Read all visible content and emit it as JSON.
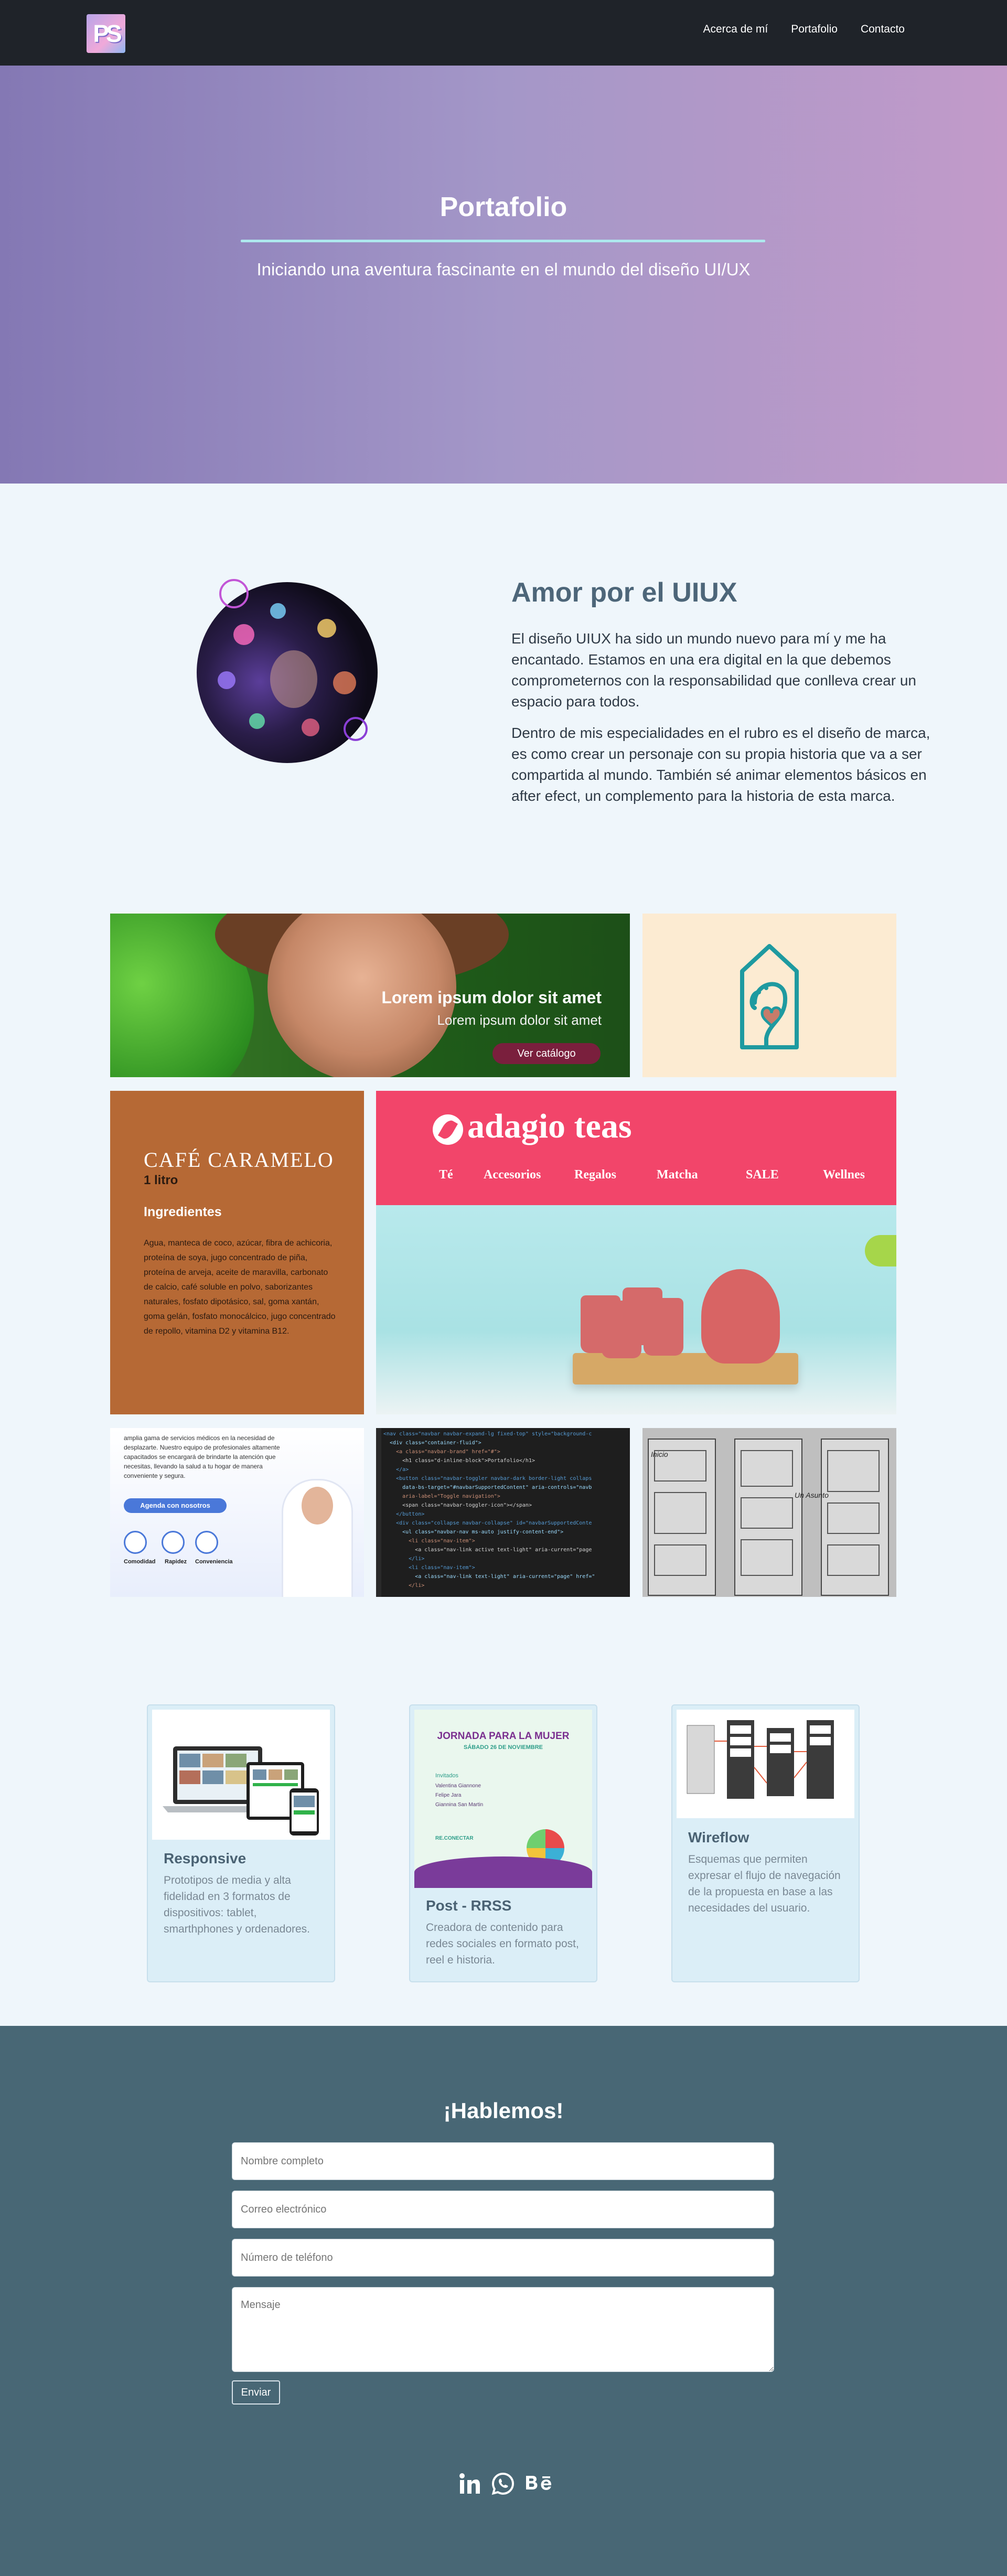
{
  "nav": {
    "brand_glyph": "PS",
    "links": [
      "Acerca de mí",
      "Portafolio",
      "Contacto"
    ]
  },
  "hero": {
    "title": "Portafolio",
    "subtitle": "Iniciando una aventura fascinante en el mundo del diseño UI/UX"
  },
  "about": {
    "title": "Amor por el UIUX",
    "p1": "El diseño UIUX ha sido un mundo nuevo para mí y me ha encantado. Estamos en una era digital en la que debemos comprometernos con la responsabilidad que conlleva crear un espacio para todos.",
    "p2": "Dentro de mis especialidades en el rubro es el diseño de marca, es como crear un personaje con su propia historia que va a ser compartida al mundo. También sé animar elementos básicos en after efect, un complemento para la historia de esta marca."
  },
  "gallery": {
    "beauty": {
      "heading": "Lorem ipsum dolor sit amet",
      "sub": "Lorem ipsum dolor sit amet",
      "button": "Ver catálogo"
    },
    "cafe": {
      "title": "CAFÉ CARAMELO",
      "size": "1 litro",
      "ingredients_title": "Ingredientes",
      "ingredients": "Agua, manteca de coco, azúcar, fibra de achicoria, proteína de soya, jugo concentrado de piña, proteína de arveja, aceite de maravilla, carbonato de calcio, café soluble en polvo, saborizantes naturales, fosfato dipotásico, sal, goma xantán, goma gelán, fosfato monocálcico, jugo concentrado de repollo, vitamina D2 y vitamina B12."
    },
    "adagio": {
      "logo": "adagio teas",
      "menu": [
        "Té",
        "Accesorios",
        "Regalos",
        "Matcha",
        "SALE",
        "Wellnes"
      ]
    },
    "medical": {
      "text": "amplia gama de servicios médicos en la necesidad de desplazarte. Nuestro equipo de profesionales altamente capacitados se encargará de brindarte la atención que necesitas, llevando la salud a tu hogar de manera conveniente y segura.",
      "button": "Agenda con nosotros",
      "icons": [
        "Comodidad",
        "Rapidez",
        "Conveniencia"
      ]
    },
    "code_lines": [
      "<nav class=\"navbar navbar-expand-lg fixed-top\" style=\"background-c",
      "  <div class=\"container-fluid\">",
      "    <a class=\"navbar-brand\" href=\"#\">",
      "      <h1 class=\"d-inline-block\">Portafolio</h1>",
      "    </a>",
      "    <button class=\"navbar-toggler navbar-dark border-light collaps",
      "      data-bs-target=\"#navbarSupportedContent\" aria-controls=\"navb",
      "      aria-label=\"Toggle navigation\">",
      "      <span class=\"navbar-toggler-icon\"></span>",
      "    </button>",
      "    <div class=\"collapse navbar-collapse\" id=\"navbarSupportedConte",
      "      <ul class=\"navbar-nav ms-auto justify-content-end\">",
      "        <li class=\"nav-item\">",
      "          <a class=\"nav-link active text-light\" aria-current=\"page",
      "        </li>",
      "        <li class=\"nav-item\">",
      "          <a class=\"nav-link text-light\" aria-current=\"page\" href=\"",
      "        </li>"
    ],
    "wire_labels": [
      "Inicio",
      "Un Asunto"
    ]
  },
  "cards": [
    {
      "title": "Responsive",
      "desc": "Prototipos de media y alta fidelidad en 3 formatos de dispositivos: tablet, smarthphones y ordenadores."
    },
    {
      "title": "Post - RRSS",
      "desc": "Creadora de contenido para redes sociales en formato post, reel e historia.",
      "poster": {
        "title": "JORNADA PARA LA MUJER",
        "date": "SÁBADO 26 DE NOVIEMBRE",
        "section": "Invitados",
        "guests": [
          "Valentina Giannone",
          "Felipe Jara",
          "Giannina San Martin"
        ],
        "footer": "RE.CONECTAR"
      }
    },
    {
      "title": "Wireflow",
      "desc": "Esquemas que permiten expresar el flujo de navegación de la propuesta en base a las necesidades del usuario."
    }
  ],
  "contact": {
    "title": "¡Hablemos!",
    "placeholders": {
      "name": "Nombre completo",
      "email": "Correo electrónico",
      "phone": "Número de teléfono",
      "message": "Mensaje"
    },
    "submit": "Enviar"
  },
  "socials": [
    "linkedin-icon",
    "whatsapp-icon",
    "behance-icon"
  ]
}
